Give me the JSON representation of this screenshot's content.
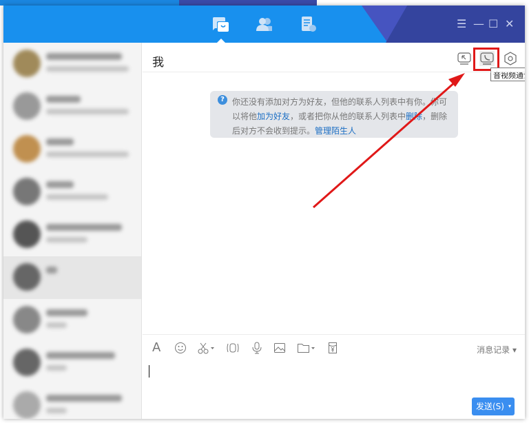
{
  "header": {
    "nav": [
      {
        "name": "messages"
      },
      {
        "name": "contacts"
      },
      {
        "name": "files"
      }
    ],
    "controls": {
      "menu": "☰",
      "minimize": "—",
      "maximize": "☐",
      "close": "✕"
    }
  },
  "sidebar": {
    "contact_count": 9,
    "selected_index": 5
  },
  "chat": {
    "title": "我",
    "tooltip": "音视频通话",
    "notice": {
      "part1": "你还没有添加对方为好友，但他的联系人列表中有你。你可以将他",
      "link_add": "加为好友",
      "part2": "，或者把你从他的联系人列表中",
      "link_delete": "删除",
      "part3": "，删除后对方不会收到提示。",
      "link_manage": "管理陌生人"
    },
    "toolbar": {
      "font": "A",
      "history": "消息记录 ▾"
    },
    "send_label": "发送(S)",
    "send_dropdown": "▾"
  },
  "colors": {
    "header": "#1890ee",
    "accent": "#3a8ef0",
    "annotation": "#e01818"
  }
}
